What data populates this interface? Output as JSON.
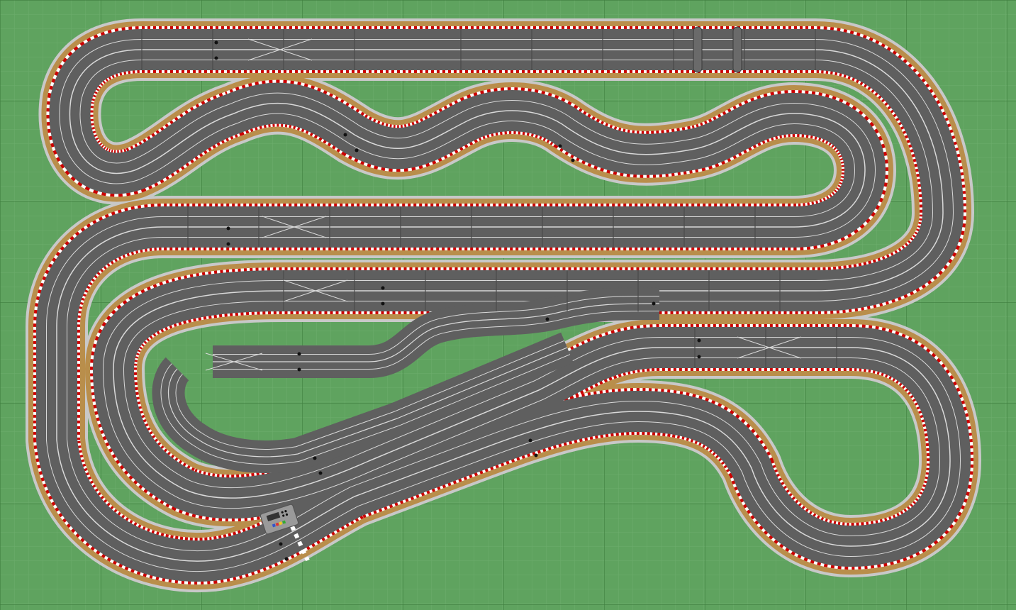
{
  "layout": {
    "type": "slot car track plan",
    "lanes": 2,
    "grid": true,
    "colors": {
      "background": "#5fa35f",
      "grid_minor": "#6cae6c",
      "grid_major": "#3f7f3f",
      "asphalt": "#5f5f5f",
      "lane_line": "#d9d9d9",
      "border": "#b98e4b",
      "outer_rim": "#c8c8c8",
      "curb_red": "#cc0000",
      "curb_white": "#ffffff",
      "seam": "#4a4a4a"
    }
  },
  "features": {
    "start_finish_line": true,
    "power_base": true,
    "lane_changers": true,
    "bridge": true
  }
}
